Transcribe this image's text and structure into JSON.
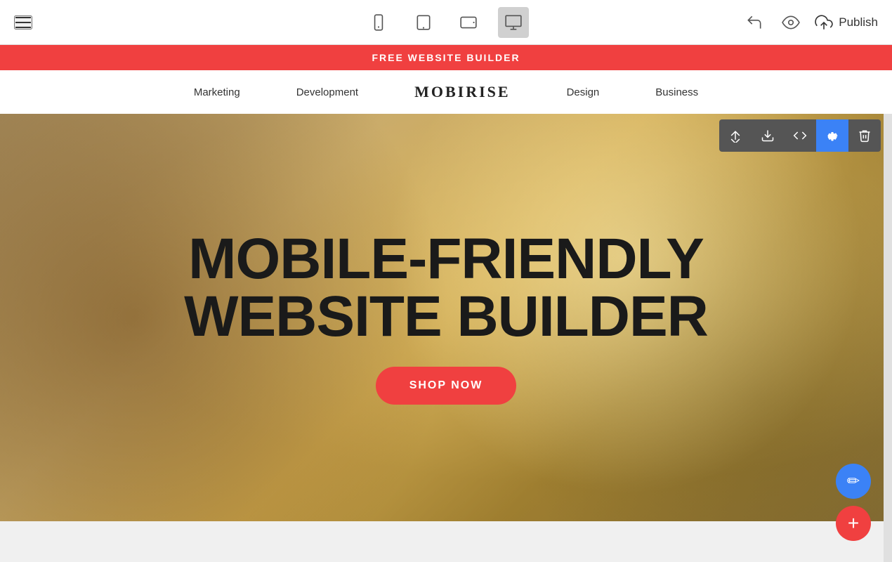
{
  "toolbar": {
    "publish_label": "Publish",
    "devices": [
      {
        "id": "mobile",
        "label": "Mobile view",
        "active": false
      },
      {
        "id": "tablet",
        "label": "Tablet view",
        "active": false
      },
      {
        "id": "tablet-landscape",
        "label": "Tablet landscape view",
        "active": false
      },
      {
        "id": "desktop",
        "label": "Desktop view",
        "active": true
      }
    ]
  },
  "promo_banner": {
    "text": "FREE WEBSITE BUILDER"
  },
  "navbar": {
    "logo": "MOBIRISE",
    "items": [
      {
        "label": "Marketing"
      },
      {
        "label": "Development"
      },
      {
        "label": "Design"
      },
      {
        "label": "Business"
      }
    ]
  },
  "hero": {
    "title_line1": "MOBILE-FRIENDLY",
    "title_line2": "WEBSITE BUILDER",
    "cta_label": "SHOP NOW"
  },
  "section_toolbar": {
    "buttons": [
      {
        "id": "move",
        "label": "Move section"
      },
      {
        "id": "download",
        "label": "Download section"
      },
      {
        "id": "code",
        "label": "Edit code"
      },
      {
        "id": "settings",
        "label": "Section settings",
        "active": true
      },
      {
        "id": "delete",
        "label": "Delete section"
      }
    ]
  },
  "fab": {
    "pencil_label": "✏",
    "plus_label": "+"
  }
}
